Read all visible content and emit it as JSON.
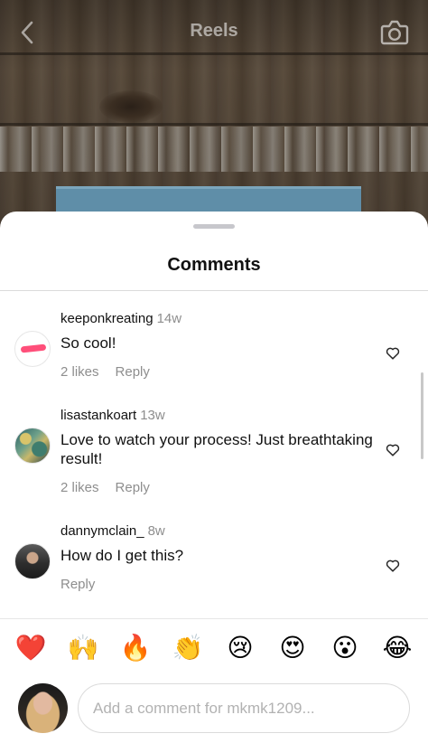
{
  "header": {
    "title": "Reels"
  },
  "sheet": {
    "title": "Comments"
  },
  "comments": [
    {
      "username": "keeponkreating",
      "time": "14w",
      "text": "So cool!",
      "likes": "2 likes",
      "reply": "Reply"
    },
    {
      "username": "lisastankoart",
      "time": "13w",
      "text": "Love to watch your process! Just breathtaking result!",
      "likes": "2 likes",
      "reply": "Reply"
    },
    {
      "username": "dannymclain_",
      "time": "8w",
      "text": "How do I get this?",
      "reply": "Reply"
    }
  ],
  "emojis": [
    "❤️",
    "🙌",
    "🔥",
    "👏",
    "😢",
    "😍",
    "😮",
    "😂"
  ],
  "composer": {
    "placeholder": "Add a comment for mkmk1209..."
  },
  "colors": {
    "text": "#111111",
    "muted": "#8e8e8e",
    "divider": "#dbdbdb"
  }
}
